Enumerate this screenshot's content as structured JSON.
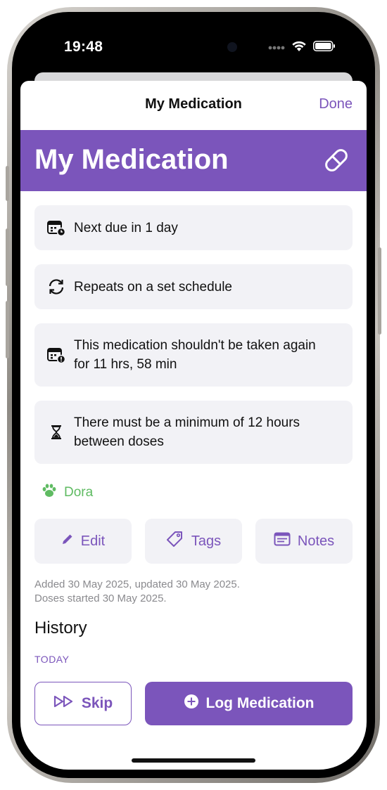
{
  "status_bar": {
    "time": "19:48"
  },
  "nav": {
    "title": "My Medication",
    "done_label": "Done"
  },
  "banner": {
    "title": "My Medication",
    "icon": "pill-icon"
  },
  "info_cards": [
    {
      "icon": "calendar-clock-icon",
      "text": "Next due in 1 day"
    },
    {
      "icon": "repeat-icon",
      "text": "Repeats on a set schedule"
    },
    {
      "icon": "calendar-alert-icon",
      "text": "This medication shouldn't be taken again for 11 hrs, 58 min"
    },
    {
      "icon": "hourglass-icon",
      "text": "There must be a minimum of 12 hours between doses"
    }
  ],
  "pet": {
    "name": "Dora",
    "icon": "paw-icon"
  },
  "actions": {
    "edit": "Edit",
    "tags": "Tags",
    "notes": "Notes"
  },
  "meta": {
    "added": "Added 30 May 2025, updated 30 May 2025.",
    "started": "Doses started 30 May 2025."
  },
  "history": {
    "title": "History",
    "section": "TODAY"
  },
  "footer": {
    "skip": "Skip",
    "log": "Log Medication"
  },
  "colors": {
    "accent": "#7b55bb",
    "pet": "#5fbb62",
    "card_bg": "#f2f2f6"
  }
}
